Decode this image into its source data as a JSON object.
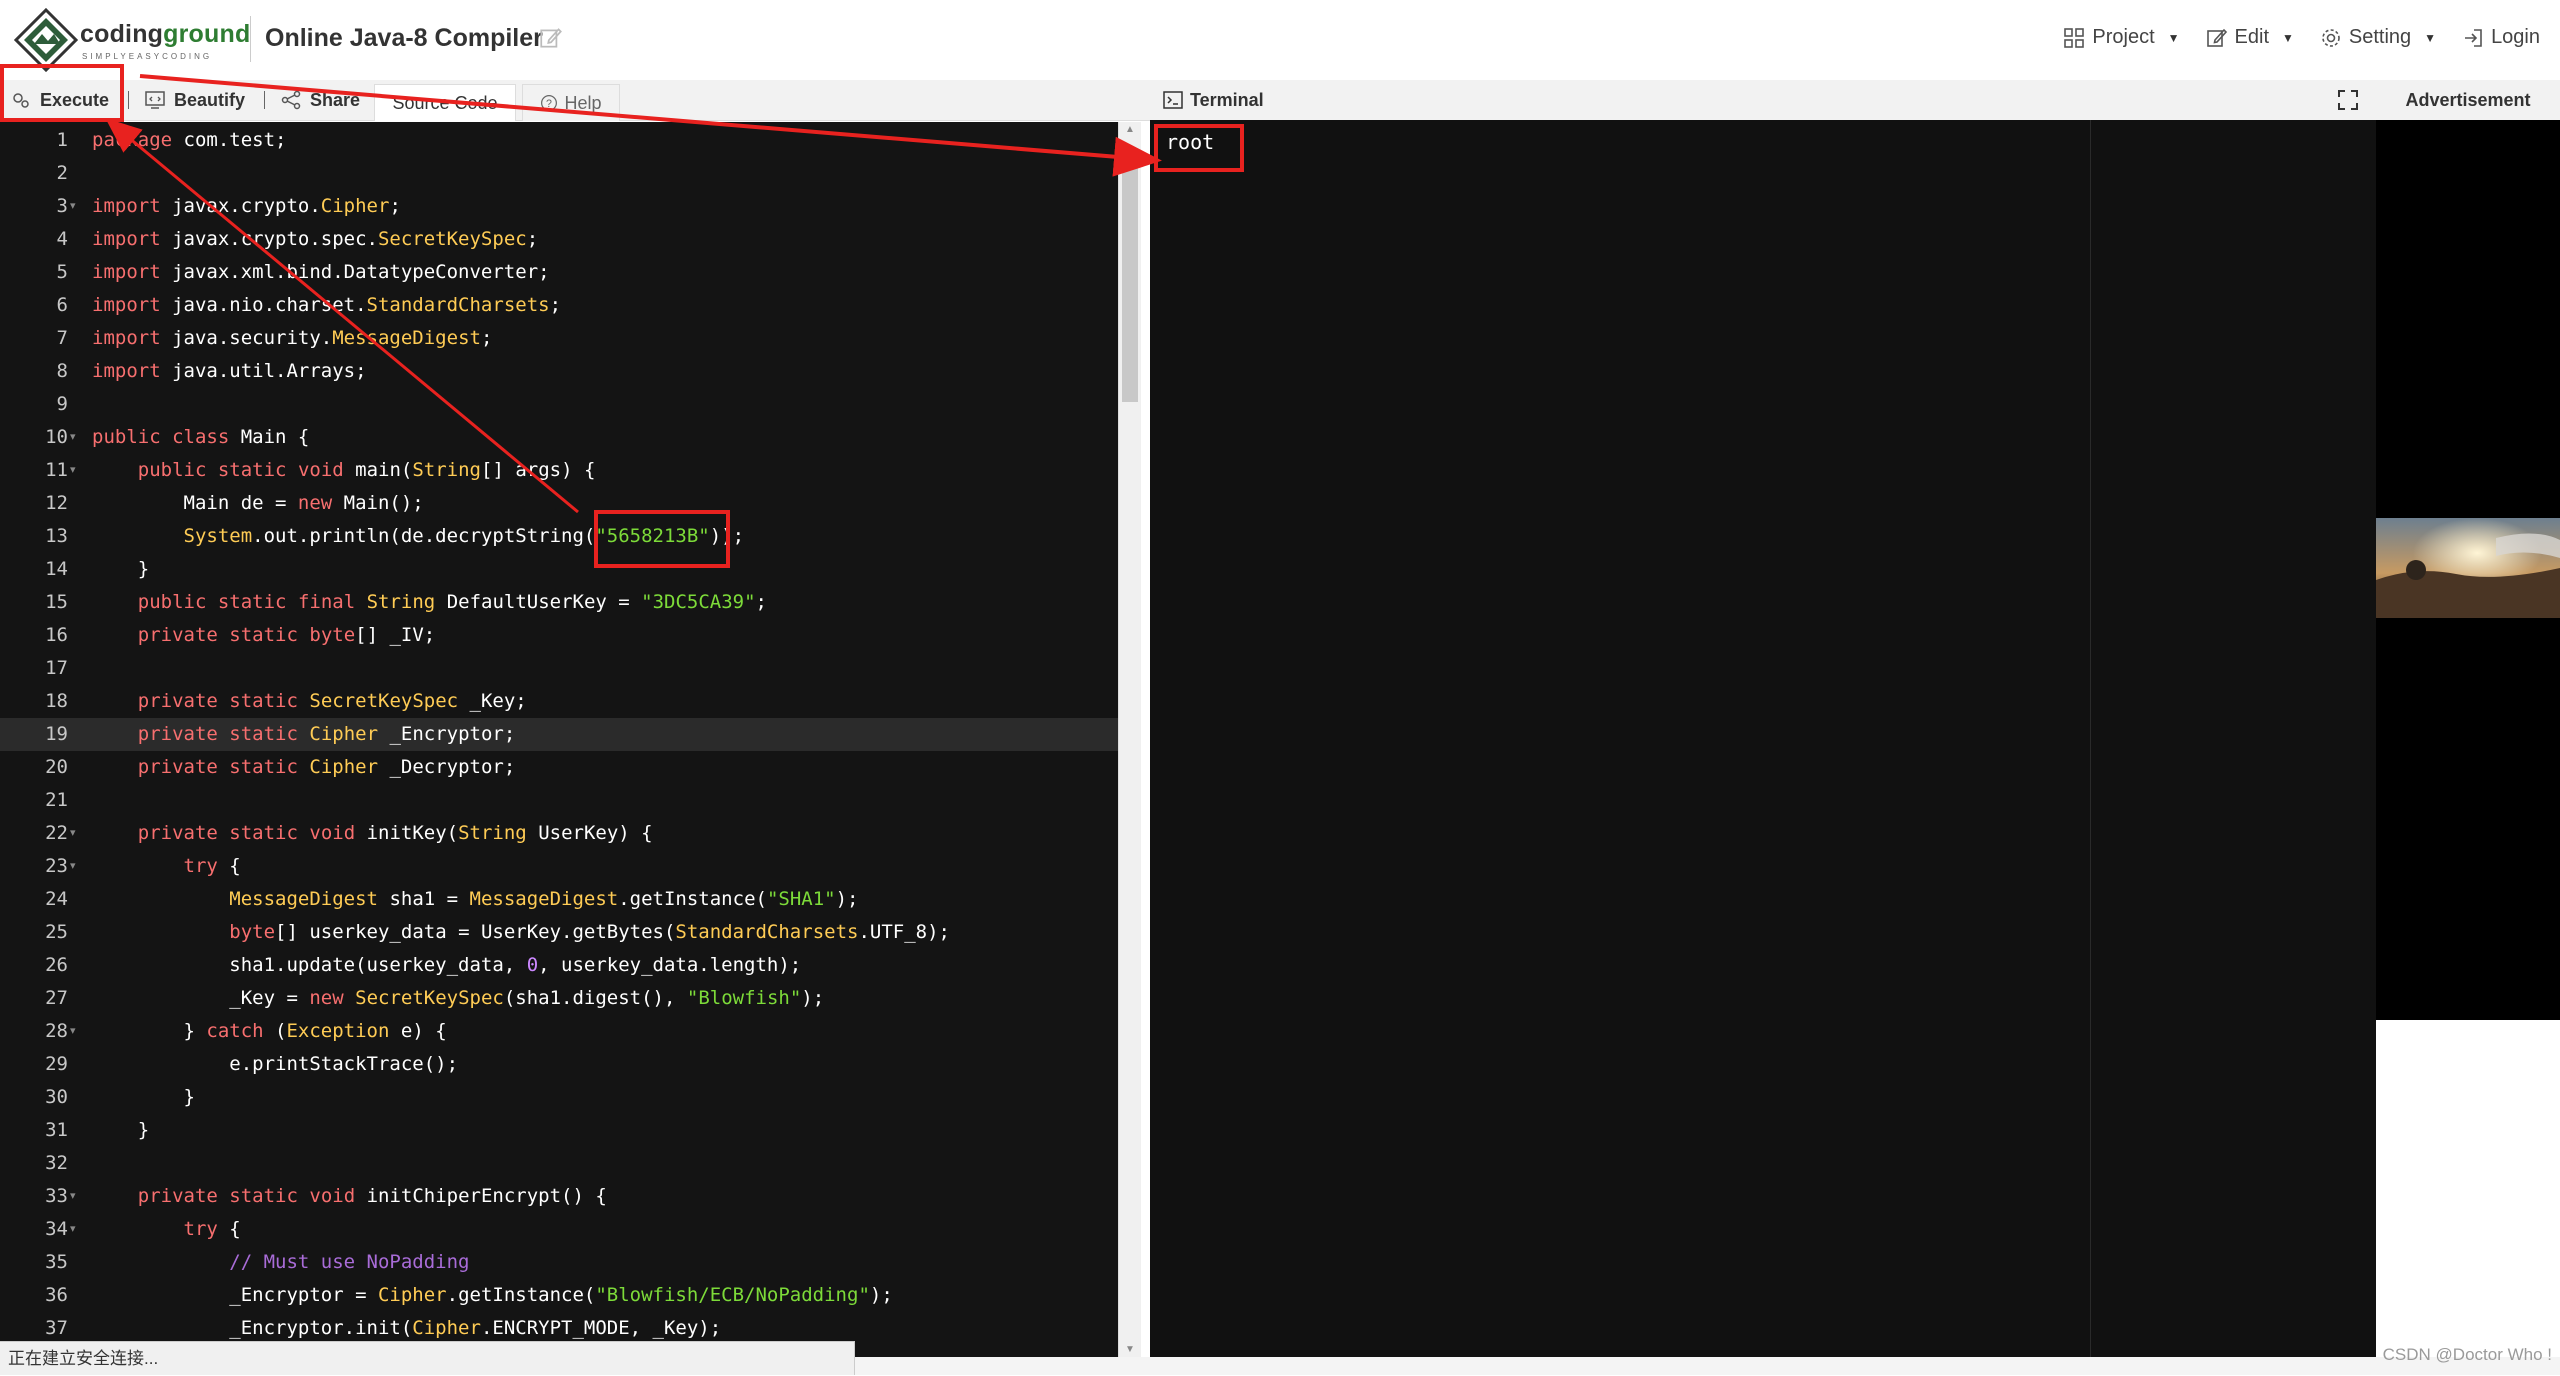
{
  "header": {
    "brand_prefix": "coding",
    "brand_suffix": "ground",
    "tagline": "SIMPLYEASYCODING",
    "title": "Online Java-8 Compiler",
    "menu": [
      {
        "label": "Project",
        "icon": "grid-icon",
        "dropdown": true
      },
      {
        "label": "Edit",
        "icon": "edit-icon",
        "dropdown": true
      },
      {
        "label": "Setting",
        "icon": "gear-icon",
        "dropdown": true
      },
      {
        "label": "Login",
        "icon": "login-icon",
        "dropdown": false
      }
    ]
  },
  "toolbar": {
    "execute_label": "Execute",
    "beautify_label": "Beautify",
    "share_label": "Share",
    "source_tab_label": "Source Code",
    "help_tab_label": "Help"
  },
  "editor": {
    "active_line": 19,
    "lines": [
      {
        "n": "1",
        "text": "package com.test;"
      },
      {
        "n": "2",
        "text": ""
      },
      {
        "n": "3",
        "text": "import javax.crypto.Cipher;",
        "fold": true
      },
      {
        "n": "4",
        "text": "import javax.crypto.spec.SecretKeySpec;"
      },
      {
        "n": "5",
        "text": "import javax.xml.bind.DatatypeConverter;"
      },
      {
        "n": "6",
        "text": "import java.nio.charset.StandardCharsets;"
      },
      {
        "n": "7",
        "text": "import java.security.MessageDigest;"
      },
      {
        "n": "8",
        "text": "import java.util.Arrays;"
      },
      {
        "n": "9",
        "text": ""
      },
      {
        "n": "10",
        "text": "public class Main {",
        "fold": true
      },
      {
        "n": "11",
        "text": "    public static void main(String[] args) {",
        "fold": true
      },
      {
        "n": "12",
        "text": "        Main de = new Main();"
      },
      {
        "n": "13",
        "text": "        System.out.println(de.decryptString(\"5658213B\"));"
      },
      {
        "n": "14",
        "text": "    }"
      },
      {
        "n": "15",
        "text": "    public static final String DefaultUserKey = \"3DC5CA39\";"
      },
      {
        "n": "16",
        "text": "    private static byte[] _IV;"
      },
      {
        "n": "17",
        "text": ""
      },
      {
        "n": "18",
        "text": "    private static SecretKeySpec _Key;"
      },
      {
        "n": "19",
        "text": "    private static Cipher _Encryptor;"
      },
      {
        "n": "20",
        "text": "    private static Cipher _Decryptor;"
      },
      {
        "n": "21",
        "text": ""
      },
      {
        "n": "22",
        "text": "    private static void initKey(String UserKey) {",
        "fold": true
      },
      {
        "n": "23",
        "text": "        try {",
        "fold": true
      },
      {
        "n": "24",
        "text": "            MessageDigest sha1 = MessageDigest.getInstance(\"SHA1\");"
      },
      {
        "n": "25",
        "text": "            byte[] userkey_data = UserKey.getBytes(StandardCharsets.UTF_8);"
      },
      {
        "n": "26",
        "text": "            sha1.update(userkey_data, 0, userkey_data.length);"
      },
      {
        "n": "27",
        "text": "            _Key = new SecretKeySpec(sha1.digest(), \"Blowfish\");"
      },
      {
        "n": "28",
        "text": "        } catch (Exception e) {",
        "fold": true
      },
      {
        "n": "29",
        "text": "            e.printStackTrace();"
      },
      {
        "n": "30",
        "text": "        }"
      },
      {
        "n": "31",
        "text": "    }"
      },
      {
        "n": "32",
        "text": ""
      },
      {
        "n": "33",
        "text": "    private static void initChiperEncrypt() {",
        "fold": true
      },
      {
        "n": "34",
        "text": "        try {",
        "fold": true
      },
      {
        "n": "35",
        "text": "            // Must use NoPadding"
      },
      {
        "n": "36",
        "text": "            _Encryptor = Cipher.getInstance(\"Blowfish/ECB/NoPadding\");"
      },
      {
        "n": "37",
        "text": "            _Encryptor.init(Cipher.ENCRYPT_MODE, _Key);"
      }
    ]
  },
  "terminal": {
    "title": "Terminal",
    "output": "root"
  },
  "advertisement": {
    "label": "Advertisement"
  },
  "status": {
    "text": "正在建立安全连接...",
    "watermark": "CSDN @Doctor Who !"
  },
  "colors": {
    "annotation": "#e8221f",
    "editor_bg": "#141414",
    "keyword": "#f76f6f",
    "type": "#ffcc55",
    "string": "#7ddb39"
  }
}
